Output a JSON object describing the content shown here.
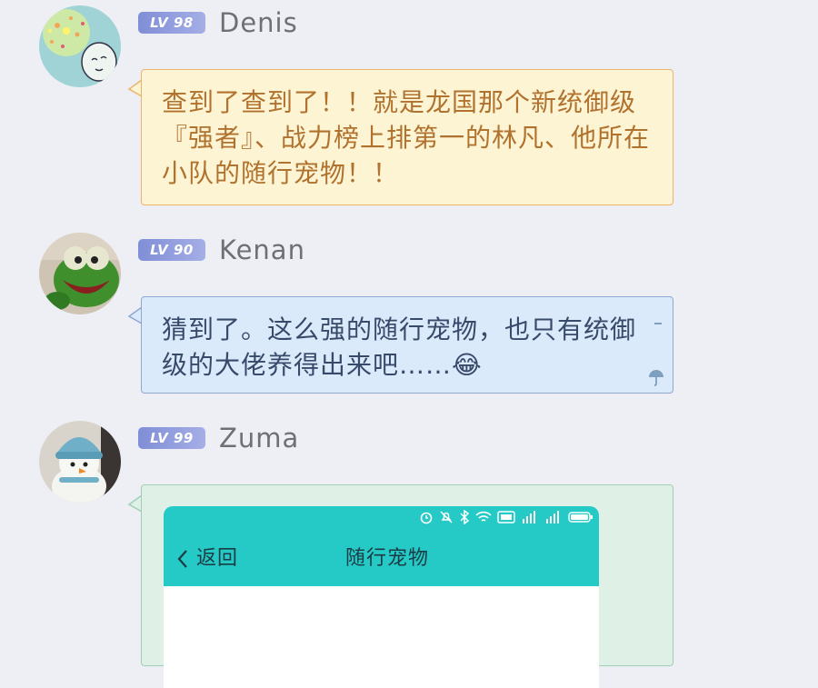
{
  "messages": [
    {
      "level": "LV 98",
      "name": "Denis",
      "text": "查到了查到了！！就是龙国那个新统御级『强者』、战力榜上排第一的林凡、他所在小队的随行宠物！！"
    },
    {
      "level": "LV 90",
      "name": "Kenan",
      "text": "猜到了。这么强的随行宠物，也只有统御级的大佬养得出来吧……😂"
    },
    {
      "level": "LV 99",
      "name": "Zuma",
      "phone": {
        "back_label": "返回",
        "title": "随行宠物",
        "status_icons": [
          "alarm-icon",
          "mute-icon",
          "bluetooth-icon",
          "wifi-icon",
          "hd-icon",
          "5g-signal-icon",
          "4g-signal-icon",
          "battery-icon"
        ]
      }
    }
  ],
  "colors": {
    "background": "#eeeff4",
    "bubble_yellow": "#fdf4d3",
    "bubble_blue": "#dbeafb",
    "bubble_green": "#dff1e7",
    "phone_header": "#25c9c6"
  }
}
